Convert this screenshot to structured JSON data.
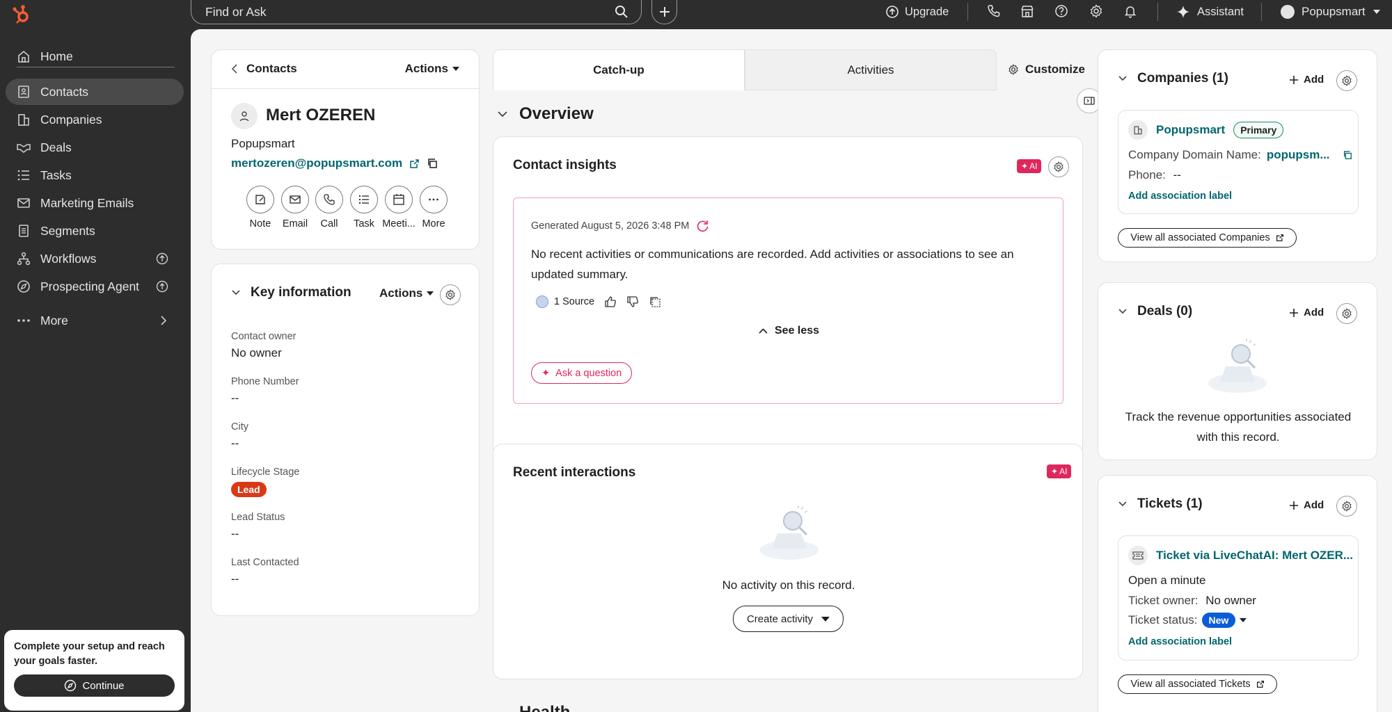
{
  "topbar": {
    "search_placeholder": "Find or Ask",
    "upgrade_label": "Upgrade",
    "assistant_label": "Assistant",
    "account_label": "Popupsmart"
  },
  "sidebar": {
    "home": "Home",
    "items": [
      {
        "label": "Contacts"
      },
      {
        "label": "Companies"
      },
      {
        "label": "Deals"
      },
      {
        "label": "Tasks"
      },
      {
        "label": "Marketing Emails"
      },
      {
        "label": "Segments"
      },
      {
        "label": "Workflows"
      },
      {
        "label": "Prospecting Agent"
      }
    ],
    "more": "More",
    "setup": {
      "text": "Complete your setup and reach your goals faster.",
      "button": "Continue"
    }
  },
  "contact": {
    "breadcrumb": "Contacts",
    "actions_label": "Actions",
    "name": "Mert OZEREN",
    "company": "Popupsmart",
    "email": "mertozeren@popupsmart.com",
    "actions": [
      {
        "label": "Note",
        "icon": "note-icon"
      },
      {
        "label": "Email",
        "icon": "email-icon"
      },
      {
        "label": "Call",
        "icon": "phone-icon"
      },
      {
        "label": "Task",
        "icon": "task-icon"
      },
      {
        "label": "Meeti...",
        "icon": "calendar-icon"
      },
      {
        "label": "More",
        "icon": "more-icon"
      }
    ]
  },
  "key_info": {
    "title": "Key information",
    "actions_label": "Actions",
    "properties": [
      {
        "label": "Contact owner",
        "value": "No owner"
      },
      {
        "label": "Phone Number",
        "value": "--"
      },
      {
        "label": "City",
        "value": "--"
      },
      {
        "label": "Lifecycle Stage",
        "value": "Lead"
      },
      {
        "label": "Lead Status",
        "value": "--"
      },
      {
        "label": "Last Contacted",
        "value": "--"
      }
    ],
    "lead_color": "#d93a16"
  },
  "tabs": {
    "catchup": "Catch-up",
    "activities": "Activities",
    "customize": "Customize"
  },
  "overview": {
    "title": "Overview",
    "insights": {
      "title": "Contact insights",
      "ai_badge": "AI",
      "generated": "Generated August 5, 2026 3:48 PM",
      "summary": "No recent activities or communications are recorded. Add activities or associations to see an updated summary.",
      "source": "1 Source",
      "see_less": "See less",
      "ask": "Ask a question"
    },
    "recent": {
      "title": "Recent interactions",
      "ai_badge": "AI",
      "empty": "No activity on this record.",
      "create": "Create activity"
    },
    "next_heading": "Health"
  },
  "companies": {
    "title": "Companies (1)",
    "add": "Add",
    "name": "Popupsmart",
    "primary": "Primary",
    "domain_label": "Company Domain Name:",
    "domain_value": "popupsm...",
    "phone_label": "Phone:",
    "phone_value": "--",
    "assoc": "Add association label",
    "view_all": "View all associated Companies"
  },
  "deals": {
    "title": "Deals (0)",
    "add": "Add",
    "empty": "Track the revenue opportunities associated with this record."
  },
  "tickets": {
    "title": "Tickets (1)",
    "add": "Add",
    "name": "Ticket via LiveChatAI: Mert OZER...",
    "opened": "Open a minute",
    "owner_label": "Ticket owner:",
    "owner_value": "No owner",
    "status_label": "Ticket status:",
    "status_value": "New",
    "assoc": "Add association label",
    "view_all": "View all associated Tickets"
  },
  "colors": {
    "accent_teal": "#00666e",
    "ai_pink": "#e0275c",
    "new_badge": "#0b5cd9",
    "brand_orange": "#ff5c35"
  }
}
